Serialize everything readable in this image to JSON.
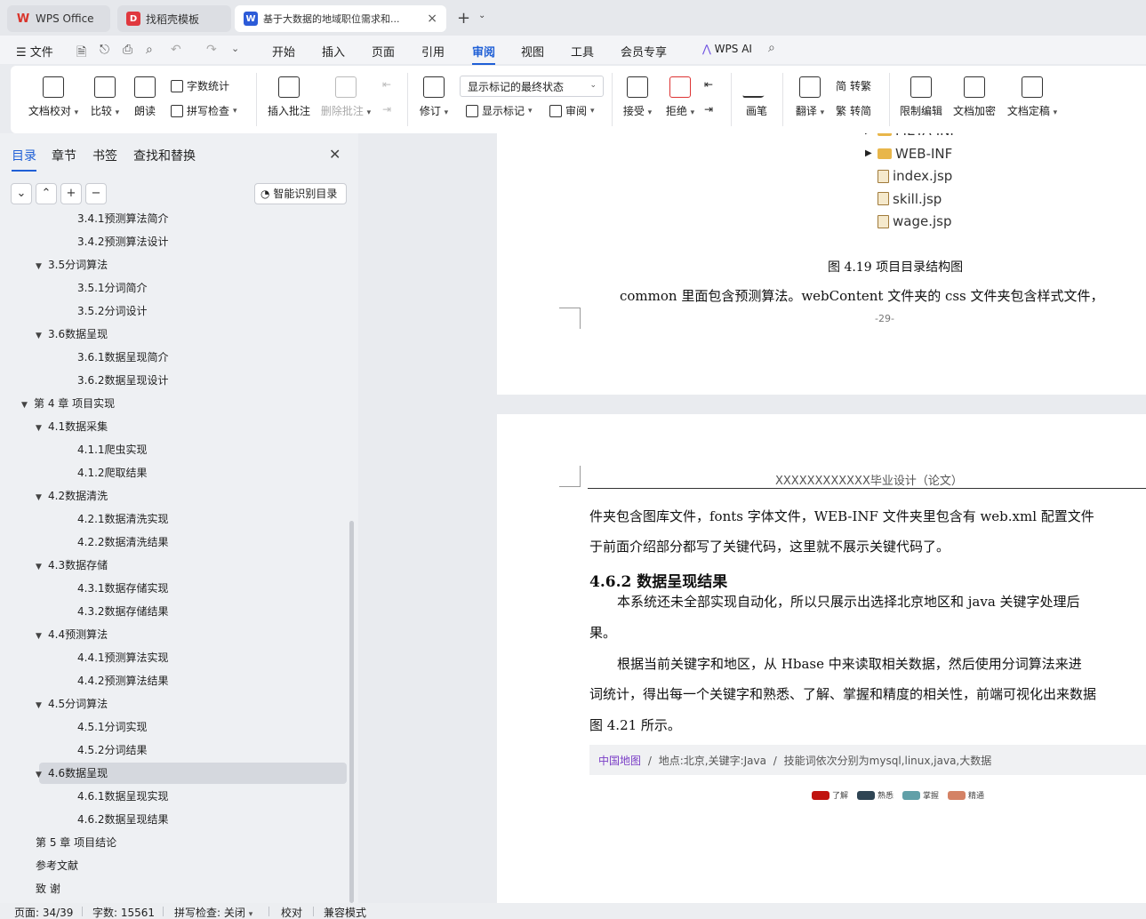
{
  "tabs": [
    {
      "label": "WPS Office",
      "icon": "wps-logo-icon",
      "color": "#d9342b"
    },
    {
      "label": "找稻壳模板",
      "icon": "docer-icon",
      "color": "#e0383e"
    },
    {
      "label": "基于大数据的地域职位需求和...",
      "icon": "writer-doc-icon",
      "color": "#2c5bd8"
    }
  ],
  "menu": {
    "file": "文件",
    "items": [
      "开始",
      "插入",
      "页面",
      "引用",
      "审阅",
      "视图",
      "工具",
      "会员专享"
    ],
    "active": "审阅",
    "wps_ai": "WPS AI"
  },
  "ribbon": {
    "doc_proof": "文档校对",
    "compare": "比较",
    "read_aloud": "朗读",
    "word_count": "字数统计",
    "spell_check": "拼写检查",
    "insert_comment": "插入批注",
    "delete_comment": "删除批注",
    "track_changes": "修订",
    "markup_state": "显示标记的最终状态",
    "show_markup": "显示标记",
    "review": "审阅",
    "accept": "接受",
    "reject": "拒绝",
    "pen": "画笔",
    "translate": "翻译",
    "to_traditional": "转繁",
    "to_simplified": "转简",
    "restrict_edit": "限制编辑",
    "encrypt": "文档加密",
    "finalize": "文档定稿"
  },
  "sidepanel": {
    "tabs": [
      "目录",
      "章节",
      "书签",
      "查找和替换"
    ],
    "active_tab": "目录",
    "smart_toc": "智能识别目录",
    "toc": [
      {
        "label": "3.4.1预测算法简介",
        "level": 3
      },
      {
        "label": "3.4.2预测算法设计",
        "level": 3
      },
      {
        "label": "3.5分词算法",
        "level": 2,
        "expanded": true
      },
      {
        "label": "3.5.1分词简介",
        "level": 3
      },
      {
        "label": "3.5.2分词设计",
        "level": 3
      },
      {
        "label": "3.6数据呈现",
        "level": 2,
        "expanded": true
      },
      {
        "label": "3.6.1数据呈现简介",
        "level": 3
      },
      {
        "label": "3.6.2数据呈现设计",
        "level": 3
      },
      {
        "label": "第 4 章  项目实现",
        "level": 1,
        "expanded": true
      },
      {
        "label": "4.1数据采集",
        "level": 2,
        "expanded": true
      },
      {
        "label": "4.1.1爬虫实现",
        "level": 3
      },
      {
        "label": "4.1.2爬取结果",
        "level": 3
      },
      {
        "label": "4.2数据清洗",
        "level": 2,
        "expanded": true
      },
      {
        "label": "4.2.1数据清洗实现",
        "level": 3
      },
      {
        "label": "4.2.2数据清洗结果",
        "level": 3
      },
      {
        "label": "4.3数据存储",
        "level": 2,
        "expanded": true
      },
      {
        "label": "4.3.1数据存储实现",
        "level": 3
      },
      {
        "label": "4.3.2数据存储结果",
        "level": 3
      },
      {
        "label": "4.4预测算法",
        "level": 2,
        "expanded": true
      },
      {
        "label": "4.4.1预测算法实现",
        "level": 3
      },
      {
        "label": "4.4.2预测算法结果",
        "level": 3
      },
      {
        "label": "4.5分词算法",
        "level": 2,
        "expanded": true
      },
      {
        "label": "4.5.1分词实现",
        "level": 3
      },
      {
        "label": "4.5.2分词结果",
        "level": 3
      },
      {
        "label": "4.6数据呈现",
        "level": 2,
        "expanded": true,
        "selected": true
      },
      {
        "label": "4.6.1数据呈现实现",
        "level": 3
      },
      {
        "label": "4.6.2数据呈现结果",
        "level": 3
      },
      {
        "label": "第 5 章  项目结论",
        "level": 1
      },
      {
        "label": "参考文献",
        "level": 1
      },
      {
        "label": "致  谢",
        "level": 1
      }
    ]
  },
  "doc": {
    "tree": [
      {
        "label": "META-INF",
        "type": "folder"
      },
      {
        "label": "WEB-INF",
        "type": "folder"
      },
      {
        "label": "index.jsp",
        "type": "file"
      },
      {
        "label": "skill.jsp",
        "type": "file"
      },
      {
        "label": "wage.jsp",
        "type": "file"
      }
    ],
    "fig_caption": "图 4.19 项目目录结构图",
    "p1": "common 里面包含预测算法。webContent 文件夹的 css 文件夹包含样式文件，",
    "page_num": "-29-",
    "header": "XXXXXXXXXXXX毕业设计（论文）",
    "p2a": "件夹包含图库文件，fonts 字体文件，WEB-INF 文件夹里包含有 web.xml 配置文件",
    "p2b": "于前面介绍部分都写了关键代码，这里就不展示关键代码了。",
    "heading": "4.6.2  数据呈现结果",
    "p3a": "本系统还未全部实现自动化，所以只展示出选择北京地区和 java 关键字处理后",
    "p3b": "果。",
    "p4a": "根据当前关键字和地区，从 Hbase 中来读取相关数据，然后使用分词算法来进",
    "p4b": "词统计，得出每一个关键字和熟悉、了解、掌握和精度的相关性，前端可视化出来数据",
    "p4c": "图 4.21 所示。",
    "breadcrumb": {
      "link": "中国地图",
      "sep": "/",
      "crumb1": "地点:北京,关键字:Java",
      "crumb2": "技能词依次分别为mysql,linux,java,大数据"
    },
    "legend": [
      {
        "label": "了解",
        "color": "#c0140f"
      },
      {
        "label": "熟悉",
        "color": "#2f4554"
      },
      {
        "label": "掌握",
        "color": "#61a0a8"
      },
      {
        "label": "精通",
        "color": "#d48265"
      }
    ]
  },
  "status": {
    "page": "页面: 34/39",
    "words": "字数: 15561",
    "spell": "拼写检查: 关闭",
    "proof": "校对",
    "compat": "兼容模式"
  }
}
